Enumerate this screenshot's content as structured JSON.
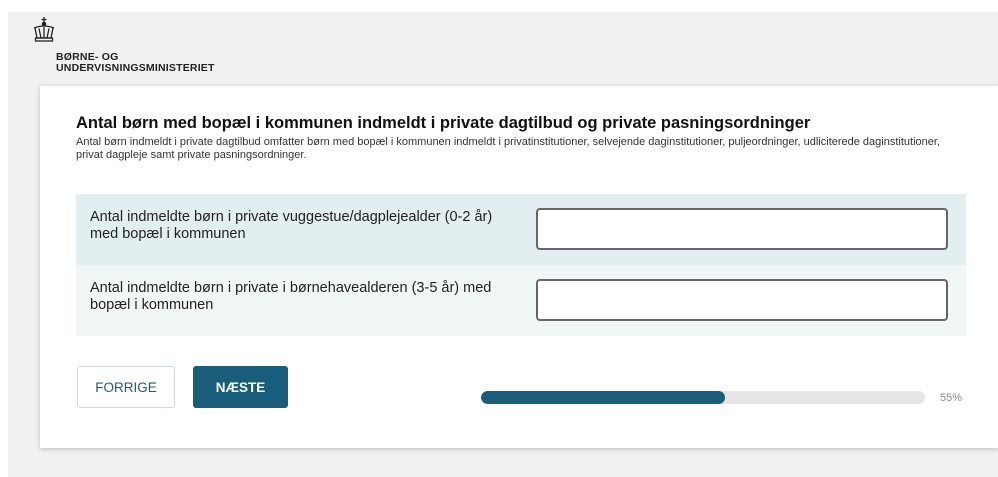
{
  "header": {
    "logo_icon": "crown-icon",
    "ministry_line1": "BØRNE- OG",
    "ministry_line2": "UNDERVISNINGSMINISTERIET"
  },
  "form": {
    "title": "Antal børn med bopæl i kommunen indmeldt i private dagtilbud og private pasningsordninger",
    "description": "Antal børn indmeldt i private dagtilbud omfatter børn med bopæl i kommunen indmeldt i privatinstitutioner, selvejende daginstitutioner, puljeordninger, udliciterede daginstitutioner, privat dagpleje samt private pasningsordninger.",
    "rows": [
      {
        "label": "Antal indmeldte børn i private vuggestue/dagplejealder (0-2 år) med bopæl i kommunen",
        "value": ""
      },
      {
        "label": "Antal indmeldte børn i private i børnehavealderen (3-5 år) med bopæl i kommunen",
        "value": ""
      }
    ]
  },
  "nav": {
    "prev_label": "FORRIGE",
    "next_label": "NÆSTE"
  },
  "progress": {
    "percent": 55,
    "label": "55%",
    "color": "#1a5d7a"
  }
}
